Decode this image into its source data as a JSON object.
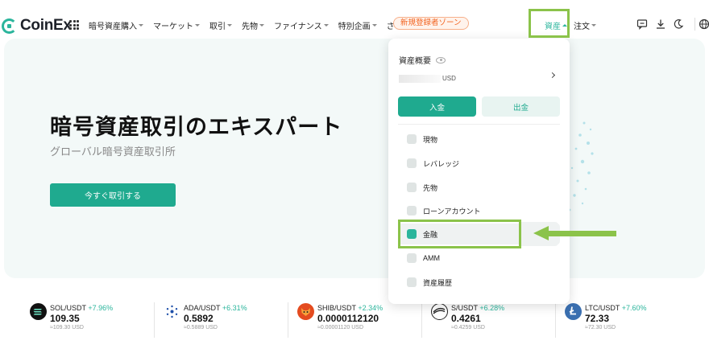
{
  "brand": {
    "name": "CoinEx",
    "accent": "#2bb59c",
    "highlight": "#8bc34a"
  },
  "nav": {
    "menu": [
      {
        "label": "暗号資産購入",
        "caret": true
      },
      {
        "label": "マーケット",
        "caret": true
      },
      {
        "label": "取引",
        "caret": true
      },
      {
        "label": "先物",
        "caret": true
      },
      {
        "label": "ファイナンス",
        "caret": true
      },
      {
        "label": "特別企画",
        "caret": true
      },
      {
        "label": "さらに",
        "caret": true
      }
    ],
    "promo": "新規登録者ゾーン",
    "assets": "資産",
    "orders": "注文",
    "icons": [
      "chat-icon",
      "download-icon",
      "moon-icon",
      "globe-icon"
    ]
  },
  "hero": {
    "title": "暗号資産取引のエキスパート",
    "subtitle": "グローバル暗号資産取引所",
    "cta": "今すぐ取引する"
  },
  "dropdown": {
    "title": "資産概要",
    "balance_unit": "USD",
    "deposit": "入金",
    "withdraw": "出金",
    "items": [
      {
        "label": "現物",
        "icon": "spot-icon"
      },
      {
        "label": "レバレッジ",
        "icon": "margin-icon"
      },
      {
        "label": "先物",
        "icon": "futures-icon"
      },
      {
        "label": "ローンアカウント",
        "icon": "loan-icon"
      },
      {
        "label": "金融",
        "icon": "finance-icon",
        "active": true
      },
      {
        "label": "AMM",
        "icon": "amm-icon"
      },
      {
        "label": "資産履歴",
        "icon": "history-icon"
      }
    ]
  },
  "ticker": [
    {
      "pair": "SOL/USDT",
      "change": "+7.96%",
      "price": "109.35",
      "usd": "≈109.30 USD",
      "icon": "sol-icon",
      "color": "#111111"
    },
    {
      "pair": "ADA/USDT",
      "change": "+6.31%",
      "price": "0.5892",
      "usd": "≈0.5889 USD",
      "icon": "ada-icon",
      "color": "#1d4fa8"
    },
    {
      "pair": "SHIB/USDT",
      "change": "+2.34%",
      "price": "0.0000112120",
      "usd": "≈0.00001120 USD",
      "icon": "shib-icon",
      "color": "#e44b1f"
    },
    {
      "pair": "S/USDT",
      "change": "+6.28%",
      "price": "0.4261",
      "usd": "≈0.4259 USD",
      "icon": "s-icon",
      "color": "#222222"
    },
    {
      "pair": "LTC/USDT",
      "change": "+7.60%",
      "price": "72.33",
      "usd": "≈72.30 USD",
      "icon": "ltc-icon",
      "color": "#3a6fb0"
    }
  ]
}
